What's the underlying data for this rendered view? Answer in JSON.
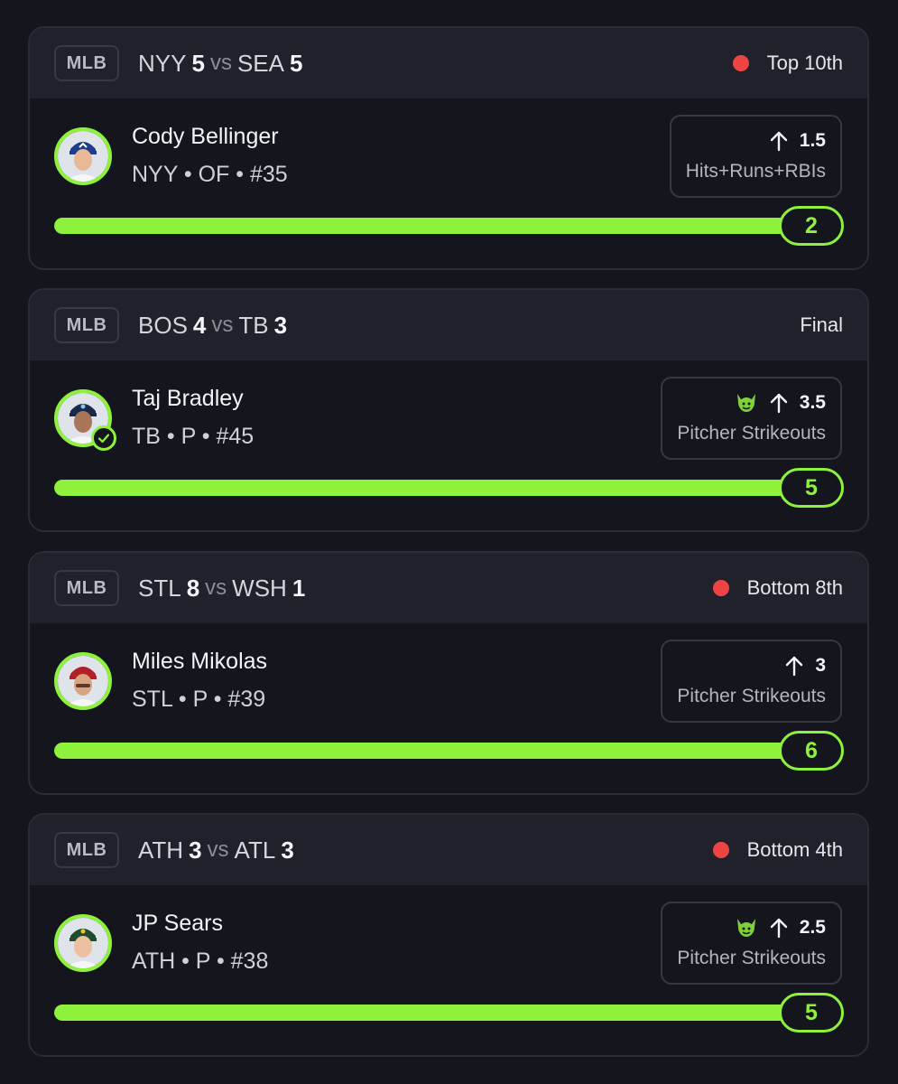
{
  "colors": {
    "accent": "#8ef23c",
    "live": "#ef4444",
    "background": "#14151d",
    "header": "#20212b"
  },
  "cards": [
    {
      "league": "MLB",
      "home": "NYY",
      "home_score": "5",
      "vs": "vs",
      "away": "SEA",
      "away_score": "5",
      "live": true,
      "status": "Top 10th",
      "player": "Cody Bellinger",
      "meta": "NYY • OF • #35",
      "avatar_icon": "player-headshot-icon",
      "direction_icon": "arrow-up-icon",
      "has_demon": false,
      "verified": false,
      "line": "1.5",
      "stat": "Hits+Runs+RBIs",
      "current": "2",
      "progress_pct": 100
    },
    {
      "league": "MLB",
      "home": "BOS",
      "home_score": "4",
      "vs": "vs",
      "away": "TB",
      "away_score": "3",
      "live": false,
      "status": "Final",
      "player": "Taj Bradley",
      "meta": "TB • P • #45",
      "avatar_icon": "player-headshot-icon",
      "direction_icon": "arrow-up-icon",
      "has_demon": true,
      "verified": true,
      "line": "3.5",
      "stat": "Pitcher Strikeouts",
      "current": "5",
      "progress_pct": 100
    },
    {
      "league": "MLB",
      "home": "STL",
      "home_score": "8",
      "vs": "vs",
      "away": "WSH",
      "away_score": "1",
      "live": true,
      "status": "Bottom 8th",
      "player": "Miles Mikolas",
      "meta": "STL • P • #39",
      "avatar_icon": "player-headshot-icon",
      "direction_icon": "arrow-up-icon",
      "has_demon": false,
      "verified": false,
      "line": "3",
      "stat": "Pitcher Strikeouts",
      "current": "6",
      "progress_pct": 100
    },
    {
      "league": "MLB",
      "home": "ATH",
      "home_score": "3",
      "vs": "vs",
      "away": "ATL",
      "away_score": "3",
      "live": true,
      "status": "Bottom 4th",
      "player": "JP Sears",
      "meta": "ATH • P • #38",
      "avatar_icon": "player-headshot-icon",
      "direction_icon": "arrow-up-icon",
      "has_demon": true,
      "verified": false,
      "line": "2.5",
      "stat": "Pitcher Strikeouts",
      "current": "5",
      "progress_pct": 100
    }
  ]
}
